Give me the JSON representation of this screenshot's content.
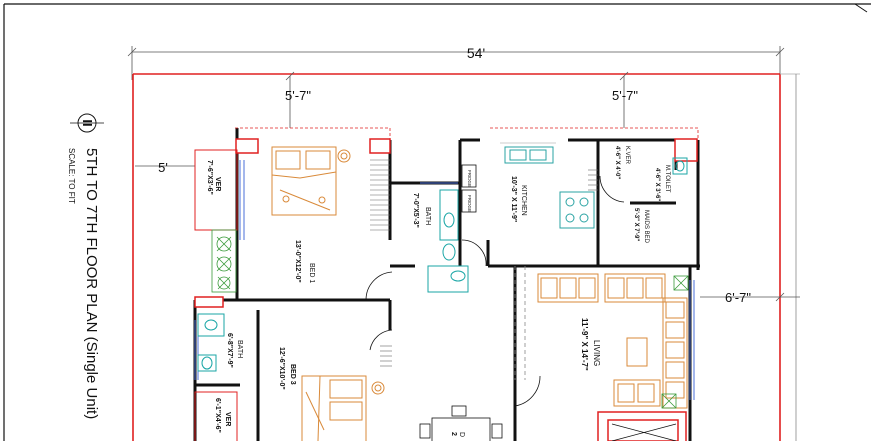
{
  "sheet": {
    "title": "5TH TO 7TH FLOOR PLAN (Single Unit)",
    "scale": "SCALE: TO FIT",
    "north_mark": "II"
  },
  "dimensions": {
    "overall_width": "54'",
    "top_left_offset": "5'-7\"",
    "top_right_offset": "5'-7\"",
    "left_offset": "5'",
    "right_offset": "6'-7\""
  },
  "rooms": {
    "ver_top": {
      "name": "VER",
      "size": "7'-6\"X3'-6\""
    },
    "bed1": {
      "name": "BED 1",
      "size": "13'-0\"X12'-0\""
    },
    "bath1": {
      "name": "BATH",
      "size": "7'-0\"X5'-3\""
    },
    "kitchen": {
      "name": "KITCHEN",
      "size": "10'-3\" X 11'-9\""
    },
    "kver": {
      "name": "K.VER",
      "size": "4'-6\" X 4'-0\""
    },
    "mtoilet": {
      "name": "M.TOILET",
      "size": "4'-6\" X 3'-6\""
    },
    "maids_bed": {
      "name": "MAIDS BED",
      "size": "5'-3\" X 7'-9\""
    },
    "living": {
      "name": "LIVING",
      "size": "11'-9\" X 14'-7\""
    },
    "bath2": {
      "name": "BATH",
      "size": "6'-8\"X7'-9\""
    },
    "bed3": {
      "name": "BED 3",
      "size": "12'-6\"X10'-0\""
    },
    "ver_bottom": {
      "name": "VER",
      "size": "6'-1\"X4'-6\""
    },
    "dining": {
      "name": "D",
      "size": "2"
    }
  },
  "fixtures": {
    "fridge_1": "FRIDGE",
    "fridge_2": "FRIDGE"
  },
  "colors": {
    "boundary": "#e02020",
    "wall": "#111111",
    "dimension": "#444444",
    "furniture": "#d98a3a",
    "sanitary": "#1aa6a6",
    "kitchen_fixture": "#2aa3a3",
    "plants": "#3a9a3a",
    "window_blue": "#4a6fd8",
    "hatch": "#666666"
  }
}
